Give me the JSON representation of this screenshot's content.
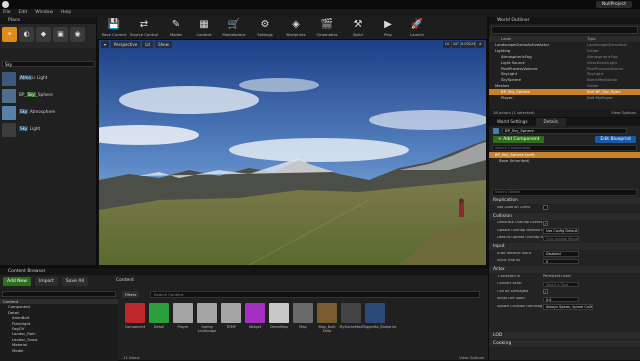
{
  "window": {
    "project": "NullProject"
  },
  "menu": [
    "File",
    "Edit",
    "Window",
    "Help"
  ],
  "place": {
    "tab": "Place",
    "search_value": "Sky",
    "items": [
      {
        "pre": "",
        "hl": "Atmo",
        "post": "ic Light",
        "style": "blue"
      },
      {
        "pre": "BP_",
        "hl": "Sky",
        "post": "_Sphere",
        "style": "green"
      },
      {
        "pre": "",
        "hl": "Sky",
        "post": " Atmosphere",
        "style": "blue"
      },
      {
        "pre": "",
        "hl": "Sky",
        "post": " Light",
        "style": "blue"
      }
    ]
  },
  "toolbar": [
    {
      "label": "Save Current",
      "icon": "💾"
    },
    {
      "label": "Source Control",
      "icon": "⇄"
    },
    {
      "label": "Modes",
      "icon": "✎"
    },
    {
      "label": "Content",
      "icon": "▦"
    },
    {
      "label": "Marketplace",
      "icon": "🛒"
    },
    {
      "label": "Settings",
      "icon": "⚙"
    },
    {
      "label": "Blueprints",
      "icon": "◈"
    },
    {
      "label": "Cinematics",
      "icon": "🎬"
    },
    {
      "label": "Build",
      "icon": "⚒"
    },
    {
      "label": "Play",
      "icon": "▶"
    },
    {
      "label": "Launch",
      "icon": "🚀"
    }
  ],
  "viewport": {
    "buttons": [
      "Perspective",
      "Lit",
      "Show"
    ],
    "right_values": [
      "10",
      "10°",
      "0.03125",
      "4"
    ]
  },
  "outliner": {
    "tab": "World Outliner",
    "columns": [
      "Label",
      "Type"
    ],
    "rows": [
      {
        "label": "LandscapeGizmoActiveActor",
        "type": "LandscapeGizmoActi"
      },
      {
        "label": "Lighting",
        "type": "Folder"
      },
      {
        "label": "AtmosphericFog",
        "type": "AtmosphericFog"
      },
      {
        "label": "Light Source",
        "type": "DirectionalLight"
      },
      {
        "label": "PostProcessVolume",
        "type": "PostProcessVolume"
      },
      {
        "label": "SkyLight",
        "type": "SkyLight"
      },
      {
        "label": "SkySphere",
        "type": "StaticMeshActor"
      },
      {
        "label": "Meshes",
        "type": "Folder"
      },
      {
        "label": "BP_Sky_Sphere",
        "type": "Edit BP_Sky_Sphe",
        "selected": true
      },
      {
        "label": "Player",
        "type": "Edit MyPlayer"
      }
    ],
    "footer_count": "18 actors (1 selected)",
    "footer_view": "View Options"
  },
  "details": {
    "tabs": [
      "World Settings",
      "Details"
    ],
    "selected_name": "BP_Sky_Sphere",
    "add_component": "+ Add Component",
    "edit_blueprint": "Edit Blueprint",
    "component_search": "Search Components",
    "self_row": "BP_Sky_Sphere (self)",
    "base_row": "Base (Inherited)",
    "search_details": "Search Details",
    "sections": {
      "replication": "Replication",
      "collision": "Collision",
      "input": "Input",
      "actor": "Actor",
      "lod": "LOD",
      "cooking": "Cooking"
    },
    "props": {
      "net_load": "Net Load on Client",
      "gen_overlap": "Generate Overlap Events Du",
      "update_overlap": "Update Overlap Method Du",
      "update_overlap_val": "Use Config Default",
      "default_overlap": "Default Update Overlap M",
      "default_overlap_val": "Only Update Movable",
      "auto_receive": "Auto Receive Input",
      "auto_receive_val": "Disabled",
      "input_priority": "Input Priority",
      "input_priority_val": "0",
      "selected_in": "1 selected in",
      "selected_in_val": "Persistent Level",
      "convert_actor": "Convert Actor",
      "convert_actor_val": "Select a Type",
      "can_be_damaged": "Can be Damaged",
      "initial_life": "Initial Life Span",
      "initial_life_val": "0.0",
      "spawn_collision": "Spawn Collision Handling M",
      "spawn_collision_val": "Always Spawn, Ignore Collisions"
    }
  },
  "content_browser": {
    "tab": "Content Browser",
    "add_new": "Add New",
    "import": "Import",
    "save_all": "Save All",
    "path": "Content",
    "tree": [
      "Content",
      "Component",
      "Detail",
      "AnimBolt",
      "Flashlight",
      "FogOV",
      "Landsc_Rain",
      "Landsc_Snow",
      "Material",
      "Model"
    ],
    "filters": "Filters",
    "asset_search": "Search Content",
    "assets": [
      {
        "name": "Component",
        "color": "#c0262d"
      },
      {
        "name": "Detail",
        "color": "#2d9f3f"
      },
      {
        "name": "Player",
        "color": "#a5a5a5"
      },
      {
        "name": "Spring Landscape",
        "color": "#a5a5a5"
      },
      {
        "name": "TEMP",
        "color": "#a5a5a5"
      },
      {
        "name": "Widget",
        "color": "#a62ec0"
      },
      {
        "name": "DemoMap",
        "color": "#c8c8c8"
      },
      {
        "name": "Map",
        "color": "#6a6a6a"
      },
      {
        "name": "Map_Built Data",
        "color": "#7a5a30"
      },
      {
        "name": "MyGameMod",
        "color": "#444444"
      },
      {
        "name": "TriggerBo_Blueprint",
        "color": "#2b4a78"
      }
    ],
    "footer_count": "11 items",
    "view_options": "View Options"
  }
}
